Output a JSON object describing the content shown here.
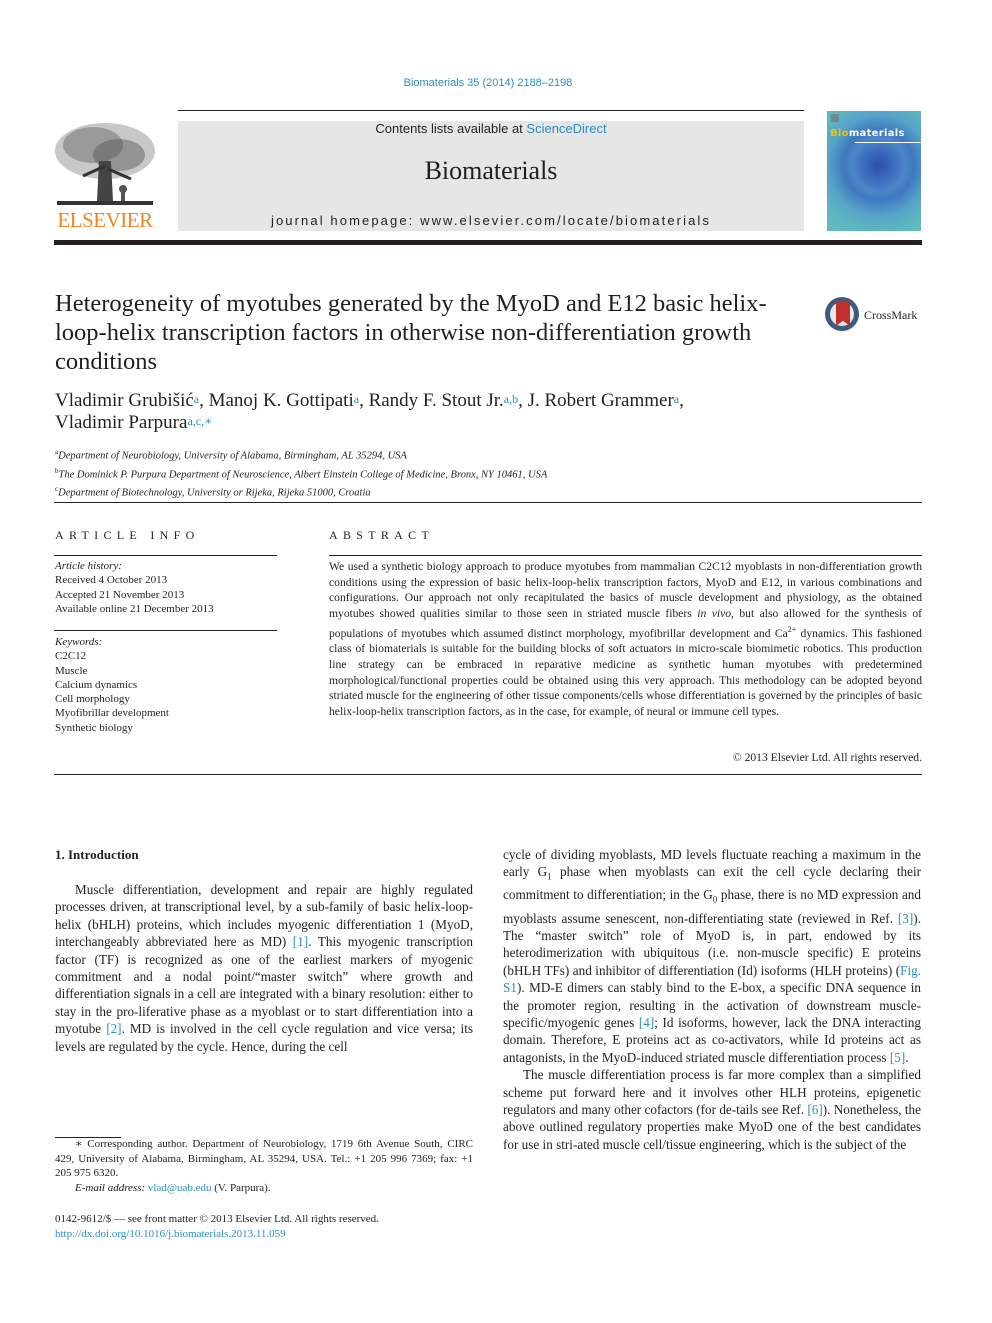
{
  "header": {
    "citation": "Biomaterials 35 (2014) 2188–2198",
    "publisher_logo_text": "ELSEVIER",
    "contents_prefix": "Contents lists available at ",
    "contents_link": "ScienceDirect",
    "journal_name": "Biomaterials",
    "homepage": "journal homepage: www.elsevier.com/locate/biomaterials",
    "cover_title_highlight": "Bio",
    "cover_title_rest": "materials"
  },
  "article": {
    "title": "Heterogeneity of myotubes generated by the MyoD and E12 basic helix-loop-helix transcription factors in otherwise non-differentiation growth conditions",
    "crossmark_label": "CrossMark",
    "authors": [
      {
        "name": "Vladimir Grubišić",
        "aff": "a",
        "sep": ", "
      },
      {
        "name": "Manoj K. Gottipati",
        "aff": "a",
        "sep": ", "
      },
      {
        "name": "Randy F. Stout Jr.",
        "aff": "a,b",
        "sep": ", "
      },
      {
        "name": "J. Robert Grammer",
        "aff": "a",
        "sep": ","
      },
      {
        "name": "Vladimir Parpura",
        "aff": "a,c,∗",
        "sep": ""
      }
    ],
    "affiliations": [
      {
        "key": "a",
        "text": "Department of Neurobiology, University of Alabama, Birmingham, AL 35294, USA"
      },
      {
        "key": "b",
        "text": "The Dominick P. Purpura Department of Neuroscience, Albert Einstein College of Medicine, Bronx, NY 10461, USA"
      },
      {
        "key": "c",
        "text": "Department of Biotechnology, University or Rijeka, Rijeka 51000, Croatia"
      }
    ]
  },
  "article_info": {
    "heading": "ARTICLE INFO",
    "history_label": "Article history:",
    "received": "Received 4 October 2013",
    "accepted": "Accepted 21 November 2013",
    "online": "Available online 21 December 2013",
    "keywords_label": "Keywords:",
    "keywords": [
      "C2C12",
      "Muscle",
      "Calcium dynamics",
      "Cell morphology",
      "Myofibrillar development",
      "Synthetic biology"
    ]
  },
  "abstract": {
    "heading": "ABSTRACT",
    "part1": "We used a synthetic biology approach to produce myotubes from mammalian C2C12 myoblasts in non-differentiation growth conditions using the expression of basic helix-loop-helix transcription factors, MyoD and E12, in various combinations and configurations. Our approach not only recapitulated the basics of muscle development and physiology, as the obtained myotubes showed qualities similar to those seen in striated muscle fibers ",
    "in_vivo": "in vivo",
    "part2": ", but also allowed for the synthesis of populations of myotubes which assumed distinct morphology, myofibrillar development and Ca",
    "ca_sup": "2+",
    "part3": " dynamics. This fashioned class of biomaterials is suitable for the building blocks of soft actuators in micro-scale biomimetic robotics. This production line strategy can be embraced in reparative medicine as synthetic human myotubes with predetermined morphological/functional properties could be obtained using this very approach. This methodology can be adopted beyond striated muscle for the engineering of other tissue components/cells whose differentiation is governed by the principles of basic helix-loop-helix transcription factors, as in the case, for example, of neural or immune cell types.",
    "copyright": "© 2013 Elsevier Ltd. All rights reserved."
  },
  "introduction": {
    "heading": "1.  Introduction",
    "left_p1_a": "Muscle differentiation, development and repair are highly regulated processes driven, at transcriptional level, by a sub-family of basic helix-loop-helix (bHLH) proteins, which includes myogenic differentiation 1 (MyoD, interchangeably abbreviated here as MD) ",
    "ref1": "[1]",
    "left_p1_b": ". This myogenic transcription factor (TF) is recognized as one of the earliest markers of myogenic commitment and a nodal point/“master switch” where growth and differentiation signals in a cell are integrated with a binary resolution: either to stay in the pro-liferative phase as a myoblast or to start differentiation into a myotube ",
    "ref2": "[2]",
    "left_p1_c": ". MD is involved in the cell cycle regulation and vice versa; its levels are regulated by the cycle. Hence, during the cell",
    "right_p1_a": "cycle of dividing myoblasts, MD levels fluctuate reaching a maximum in the early G",
    "g1_sub": "1",
    "right_p1_b": " phase when myoblasts can exit the cell cycle declaring their commitment to differentiation; in the G",
    "g0_sub": "0",
    "right_p1_c": " phase, there is no MD expression and myoblasts assume senescent, non-differentiating state (reviewed in Ref. ",
    "ref3": "[3]",
    "right_p1_d": "). The “master switch” role of MyoD is, in part, endowed by its heterodimerization with ubiquitous (i.e. non-muscle specific) E proteins (bHLH TFs) and inhibitor of differentiation (Id) isoforms (HLH proteins) (",
    "fig_s1": "Fig. S1",
    "right_p1_e": "). MD-E dimers can stably bind to the E-box, a specific DNA sequence in the promoter region, resulting in the activation of downstream muscle-specific/myogenic genes ",
    "ref4": "[4]",
    "right_p1_f": "; Id isoforms, however, lack the DNA interacting domain. Therefore, E proteins act as co-activators, while Id proteins act as antagonists, in the MyoD-induced striated muscle differentiation process ",
    "ref5": "[5]",
    "right_p1_g": ".",
    "right_p2_a": "The muscle differentiation process is far more complex than a simplified scheme put forward here and it involves other HLH proteins, epigenetic regulators and many other cofactors (for de-tails see Ref. ",
    "ref6": "[6]",
    "right_p2_b": "). Nonetheless, the above outlined regulatory properties make MyoD one of the best candidates for use in stri-ated muscle cell/tissue engineering, which is the subject of the"
  },
  "footnote": {
    "corresponding": "∗ Corresponding author. Department of Neurobiology, 1719 6th Avenue South, CIRC 429, University of Alabama, Birmingham, AL 35294, USA. Tel.: +1 205 996 7369; fax: +1 205 975 6320.",
    "email_label": "E-mail address: ",
    "email": "vlad@uab.edu",
    "email_suffix": " (V. Parpura).",
    "issn": "0142-9612/$ — see front matter © 2013 Elsevier Ltd. All rights reserved.",
    "doi": "http://dx.doi.org/10.1016/j.biomaterials.2013.11.059"
  }
}
